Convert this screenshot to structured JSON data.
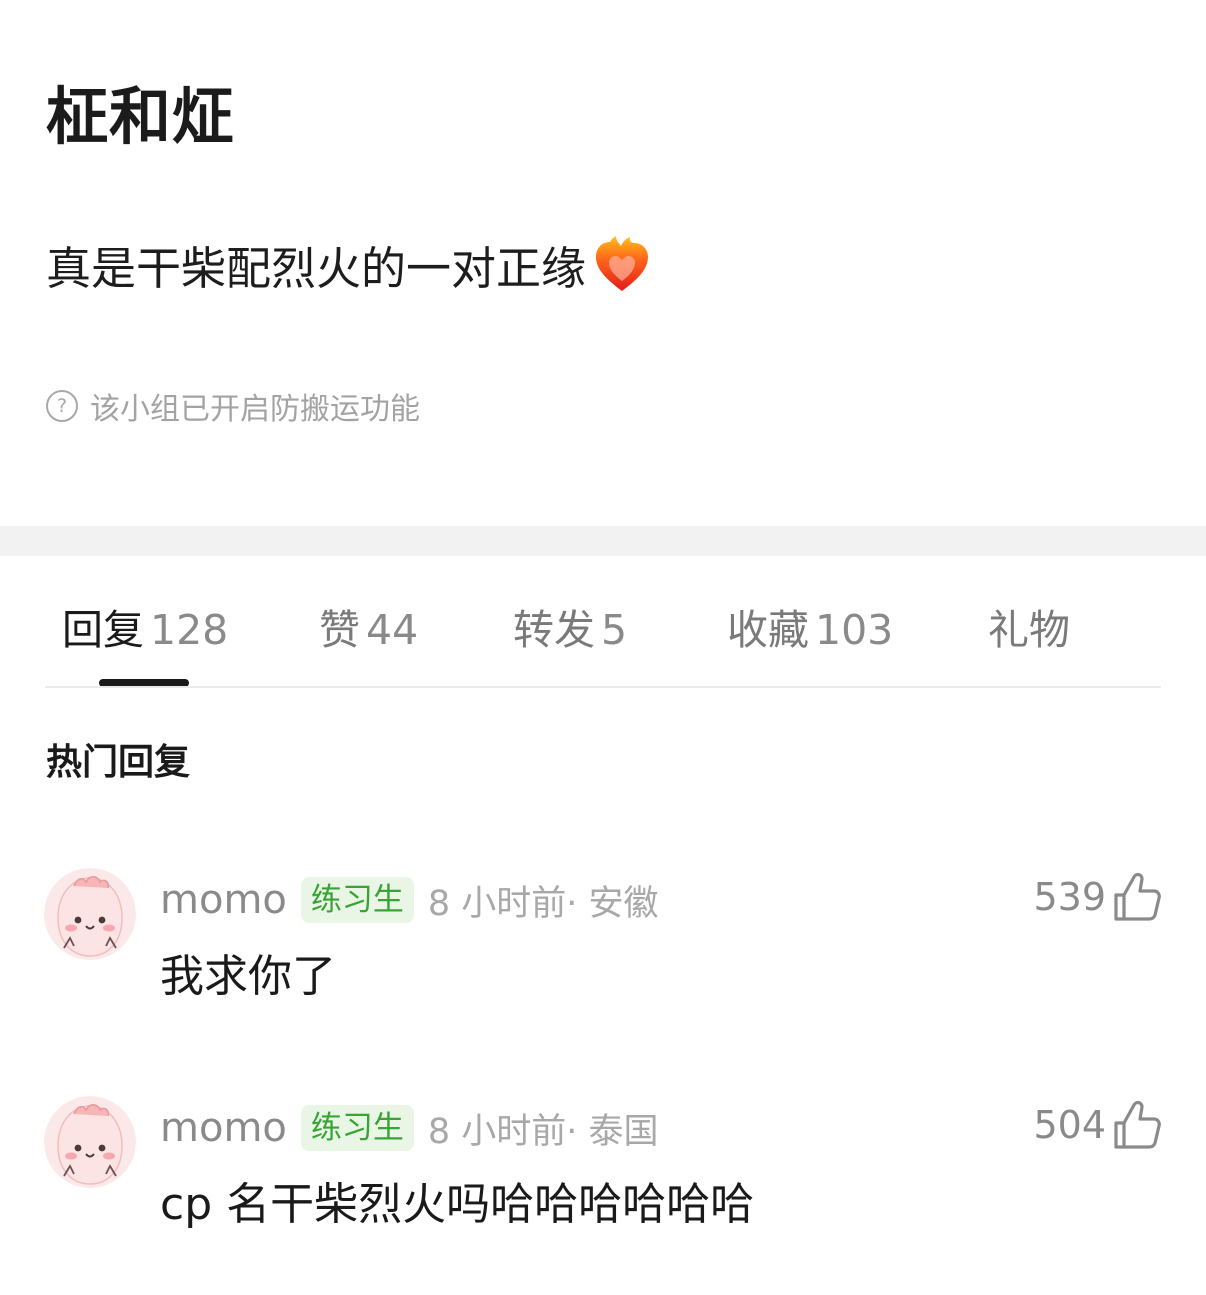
{
  "post": {
    "title": "柾和炡",
    "body": "真是干柴配烈火的一对正缘",
    "body_emoji": "heart-on-fire-icon",
    "notice": "该小组已开启防搬运功能",
    "notice_icon": "question-circle-icon"
  },
  "tabs": [
    {
      "label": "回复",
      "count": "128",
      "active": true
    },
    {
      "label": "赞",
      "count": "44",
      "active": false
    },
    {
      "label": "转发",
      "count": "5",
      "active": false
    },
    {
      "label": "收藏",
      "count": "103",
      "active": false
    },
    {
      "label": "礼物",
      "count": "",
      "active": false
    }
  ],
  "section_title": "热门回复",
  "comments": [
    {
      "user": "momo",
      "badge": "练习生",
      "time": "8 小时前",
      "location": " · 安徽",
      "text": "我求你了",
      "likes": "539"
    },
    {
      "user": "momo",
      "badge": "练习生",
      "time": "8 小时前",
      "location": " · 泰国",
      "text": "cp 名干柴烈火吗哈哈哈哈哈哈",
      "likes": "504"
    }
  ],
  "colors": {
    "badge_bg": "#e9f6e6",
    "badge_text": "#3aa336",
    "muted_text": "#a8a8a8",
    "separator": "#f2f2f2"
  }
}
